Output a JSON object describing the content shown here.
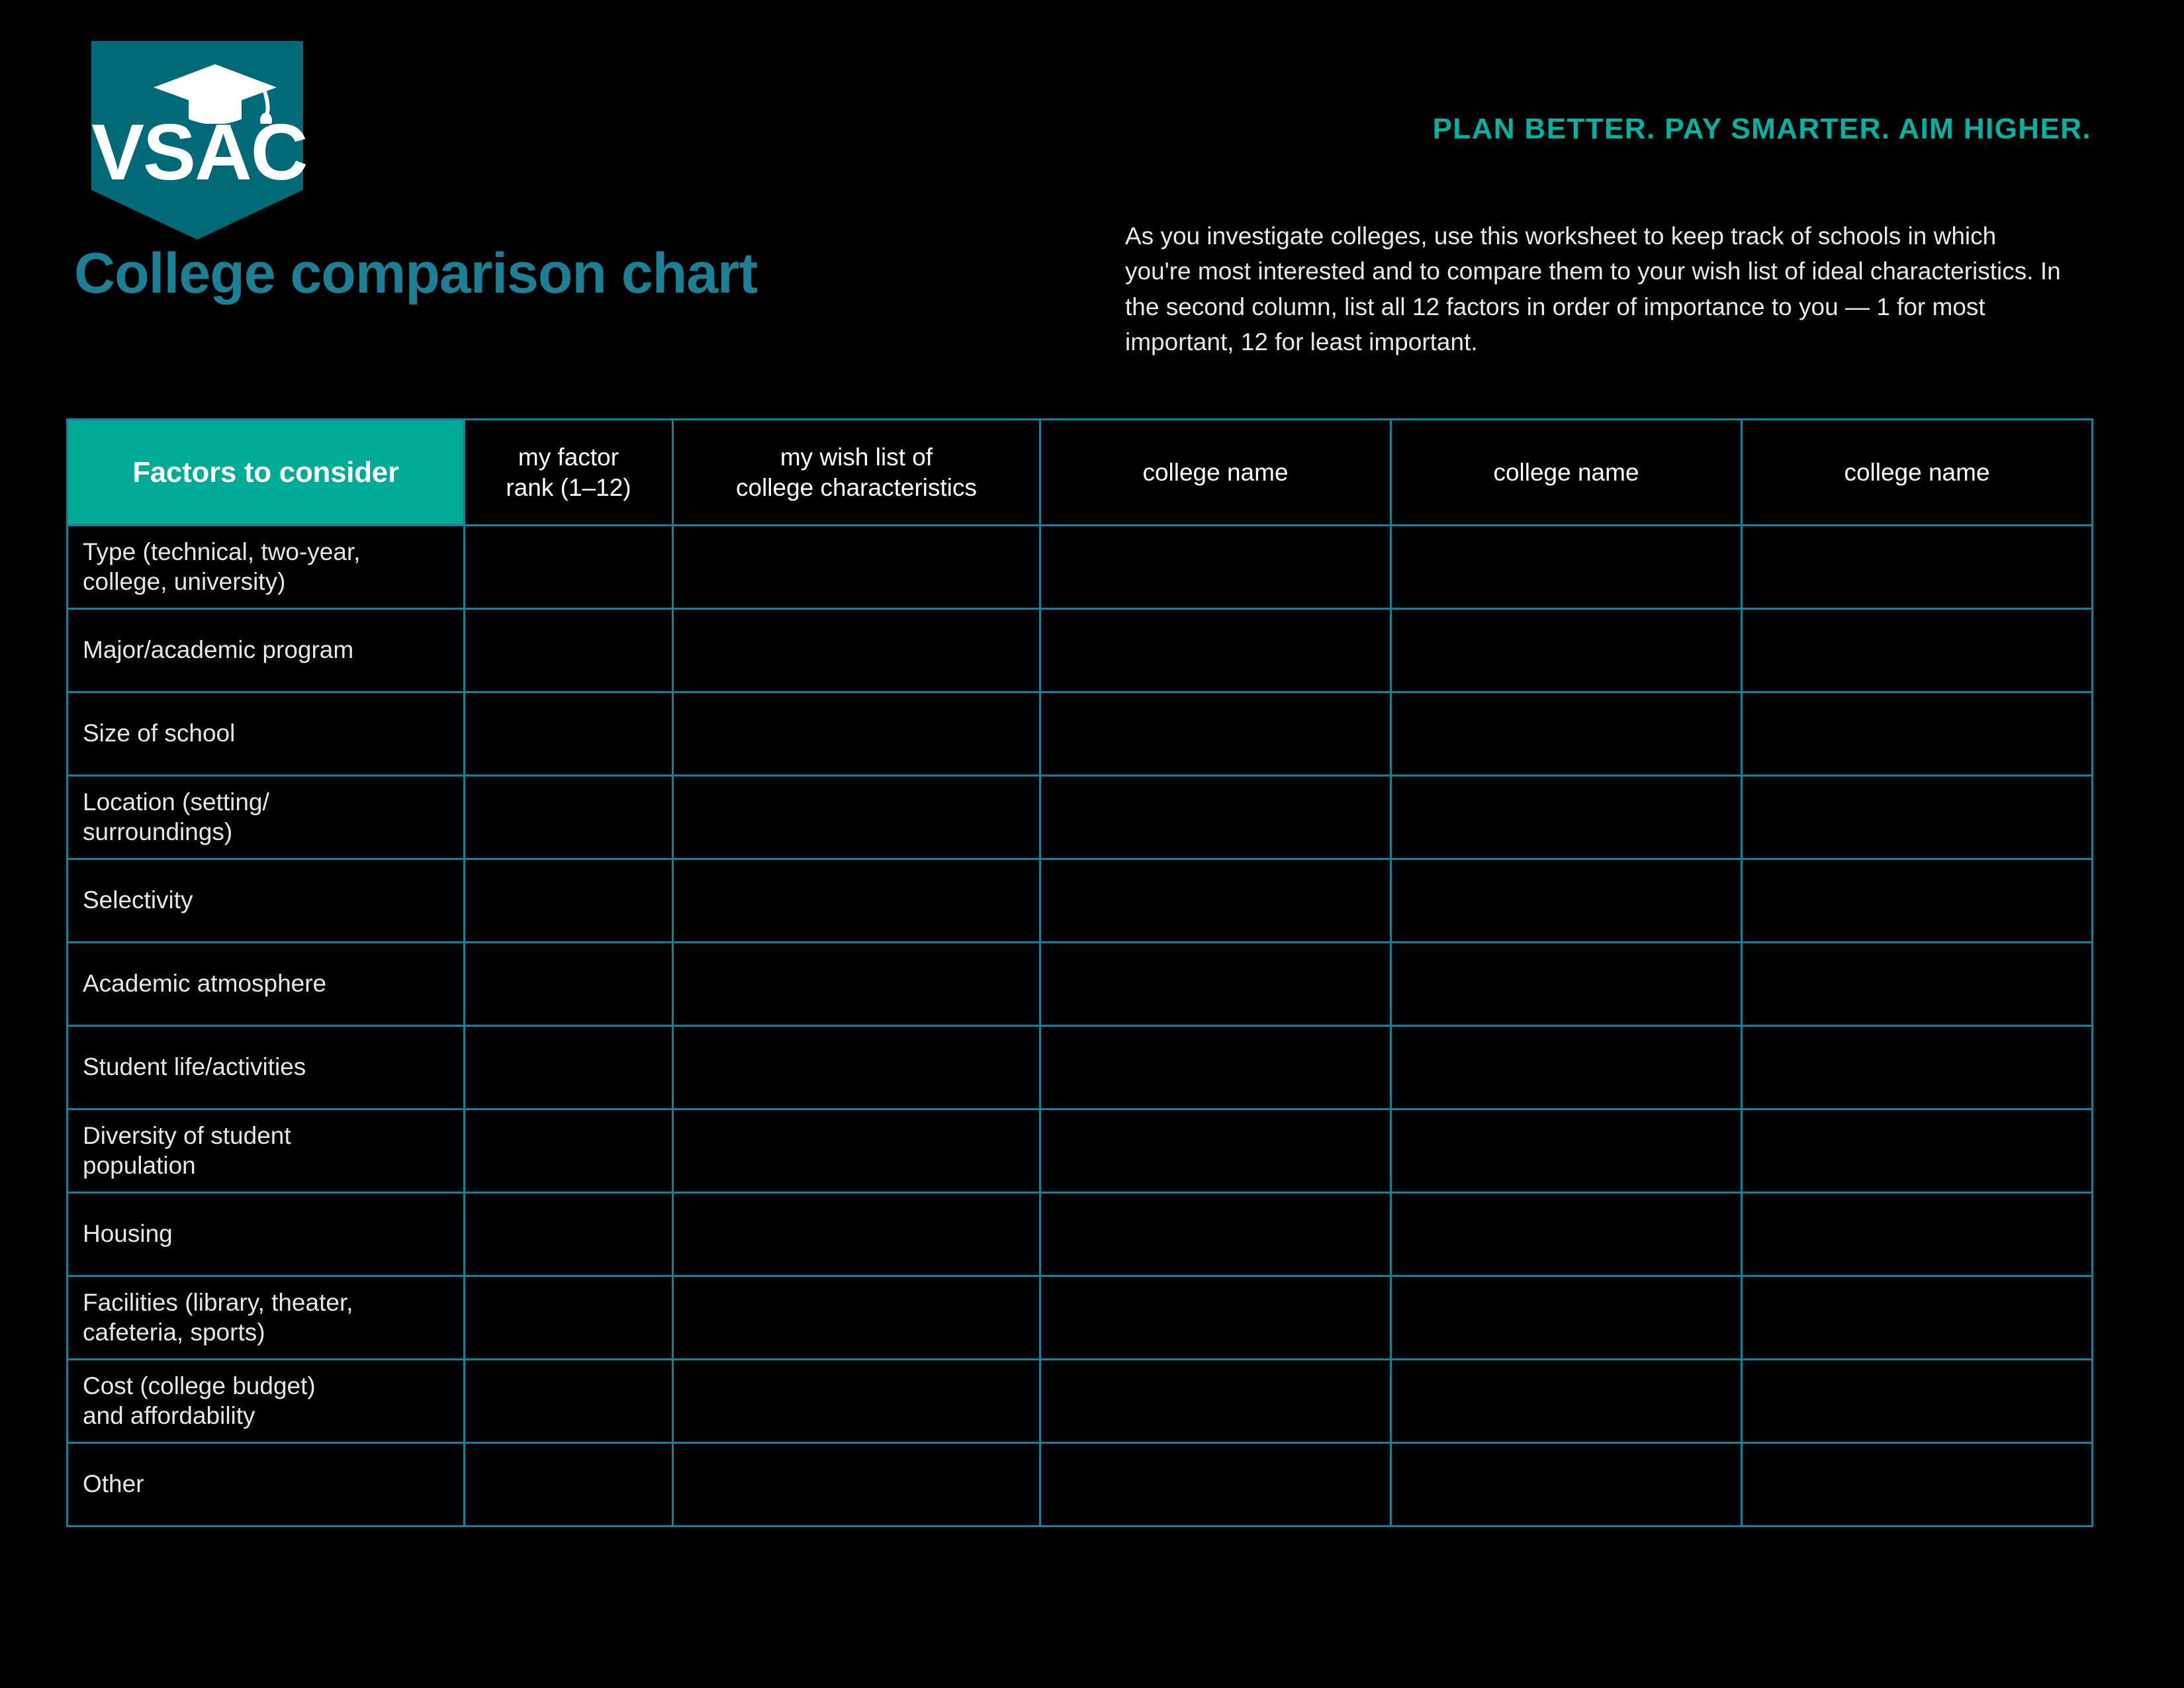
{
  "brand": {
    "logo_text": "VSAC",
    "logo_icon": "graduation-cap-icon",
    "tagline": "PLAN BETTER. PAY SMARTER. AIM HIGHER.",
    "colors": {
      "logo_teal": "#006a78",
      "header_teal": "#00ab96",
      "border_teal": "#1c7d93",
      "title_teal": "#1d7f95",
      "tagline_teal": "#00b3a0",
      "background": "#000000",
      "text_light": "#e6e6e6"
    }
  },
  "header": {
    "title": "College comparison chart",
    "intro": "As you investigate colleges, use this worksheet to keep track of schools in which you're most interested and to compare them to your wish list of ideal characteristics. In the second column, list all 12 factors in order of importance to you — 1 for most important, 12 for least important."
  },
  "table": {
    "columns": [
      {
        "label": "Factors to consider",
        "key": "factor"
      },
      {
        "label": "my factor\nrank (1–12)",
        "line1": "my factor",
        "line2": "rank (1–12)",
        "key": "rank"
      },
      {
        "label": "my wish list of\ncollege characteristics",
        "line1": "my wish list of",
        "line2": "college characteristics",
        "key": "wish"
      },
      {
        "label": "college name",
        "key": "college1"
      },
      {
        "label": "college name",
        "key": "college2"
      },
      {
        "label": "college name",
        "key": "college3"
      }
    ],
    "rows": [
      {
        "factor_line1": "Type (technical, two-year,",
        "factor_line2": "college, university)",
        "rank": "",
        "wish": "",
        "college1": "",
        "college2": "",
        "college3": ""
      },
      {
        "factor_line1": "Major/academic program",
        "factor_line2": "",
        "rank": "",
        "wish": "",
        "college1": "",
        "college2": "",
        "college3": ""
      },
      {
        "factor_line1": "Size of school",
        "factor_line2": "",
        "rank": "",
        "wish": "",
        "college1": "",
        "college2": "",
        "college3": ""
      },
      {
        "factor_line1": "Location (setting/",
        "factor_line2": "surroundings)",
        "rank": "",
        "wish": "",
        "college1": "",
        "college2": "",
        "college3": ""
      },
      {
        "factor_line1": "Selectivity",
        "factor_line2": "",
        "rank": "",
        "wish": "",
        "college1": "",
        "college2": "",
        "college3": ""
      },
      {
        "factor_line1": "Academic atmosphere",
        "factor_line2": "",
        "rank": "",
        "wish": "",
        "college1": "",
        "college2": "",
        "college3": ""
      },
      {
        "factor_line1": "Student life/activities",
        "factor_line2": "",
        "rank": "",
        "wish": "",
        "college1": "",
        "college2": "",
        "college3": ""
      },
      {
        "factor_line1": "Diversity of student",
        "factor_line2": "population",
        "rank": "",
        "wish": "",
        "college1": "",
        "college2": "",
        "college3": ""
      },
      {
        "factor_line1": "Housing",
        "factor_line2": "",
        "rank": "",
        "wish": "",
        "college1": "",
        "college2": "",
        "college3": ""
      },
      {
        "factor_line1": "Facilities (library, theater,",
        "factor_line2": "cafeteria, sports)",
        "rank": "",
        "wish": "",
        "college1": "",
        "college2": "",
        "college3": ""
      },
      {
        "factor_line1": "Cost (college budget)",
        "factor_line2": "and affordability",
        "rank": "",
        "wish": "",
        "college1": "",
        "college2": "",
        "college3": ""
      },
      {
        "factor_line1": "Other",
        "factor_line2": "",
        "rank": "",
        "wish": "",
        "college1": "",
        "college2": "",
        "college3": ""
      }
    ]
  }
}
